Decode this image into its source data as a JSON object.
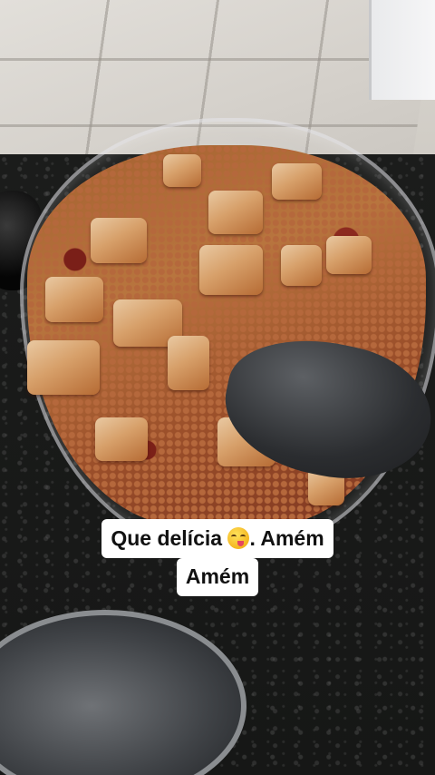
{
  "caption": {
    "line1_text": "Que delícia ",
    "line1_suffix": ". Amém",
    "line2_text": "Amém",
    "emoji_icon": "face-savoring-food-emoji"
  },
  "scene": {
    "subject": "bowl of farofa with torresmo",
    "colors": {
      "caption_bg": "#ffffff",
      "caption_text": "#111111",
      "food_main": "#b8753e",
      "crackling": "#e9c9a2",
      "spoon": "#2b2d30",
      "counter": "#161716"
    }
  }
}
